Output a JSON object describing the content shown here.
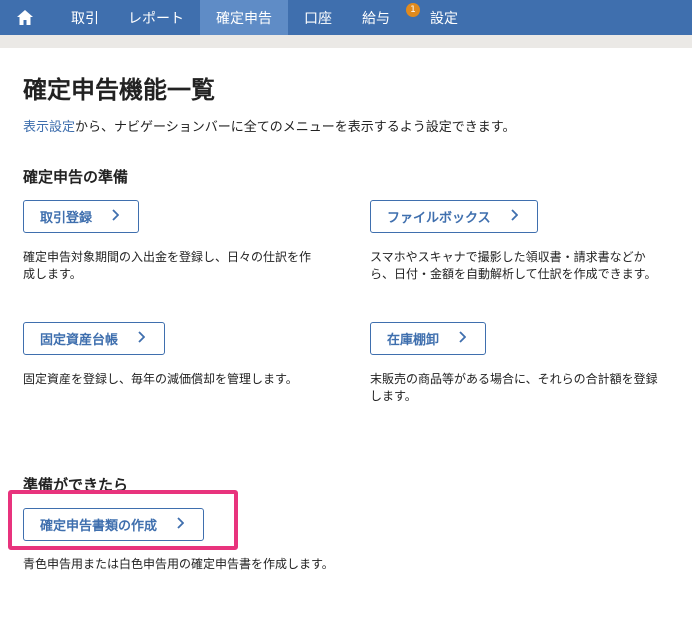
{
  "nav": {
    "items": [
      {
        "label": "取引"
      },
      {
        "label": "レポート"
      },
      {
        "label": "確定申告"
      },
      {
        "label": "口座"
      },
      {
        "label": "給与"
      },
      {
        "label": "設定",
        "badge": "1"
      }
    ]
  },
  "page": {
    "title": "確定申告機能一覧",
    "intro_link": "表示設定",
    "intro_text": "から、ナビゲーションバーに全てのメニューを表示するよう設定できます。"
  },
  "prep": {
    "title": "確定申告の準備",
    "cards": [
      {
        "label": "取引登録",
        "desc_lines": [
          "確定申告対象期間の入出金を登録し、日々の仕訳を作",
          "成します。"
        ]
      },
      {
        "label": "ファイルボックス",
        "desc_lines": [
          "スマホやスキャナで撮影した領収書・請求書などか",
          "ら、日付・金額を自動解析して仕訳を作成できます。"
        ]
      },
      {
        "label": "固定資産台帳",
        "desc_lines": [
          "固定資産を登録し、毎年の減価償却を管理します。"
        ]
      },
      {
        "label": "在庫棚卸",
        "desc_lines": [
          "末販売の商品等がある場合に、それらの合計額を登録",
          "します。"
        ]
      }
    ]
  },
  "ready": {
    "title": "準備ができたら",
    "button": "確定申告書類の作成",
    "desc": "青色申告用または白色申告用の確定申告書を作成します。"
  },
  "colors": {
    "nav": "#3f6fae",
    "active_tab": "#5f8cc6",
    "badge": "#e08a1e",
    "highlight": "#e8337d"
  },
  "icons": {
    "home": "home-icon",
    "chevron": "chevron-right-icon"
  }
}
